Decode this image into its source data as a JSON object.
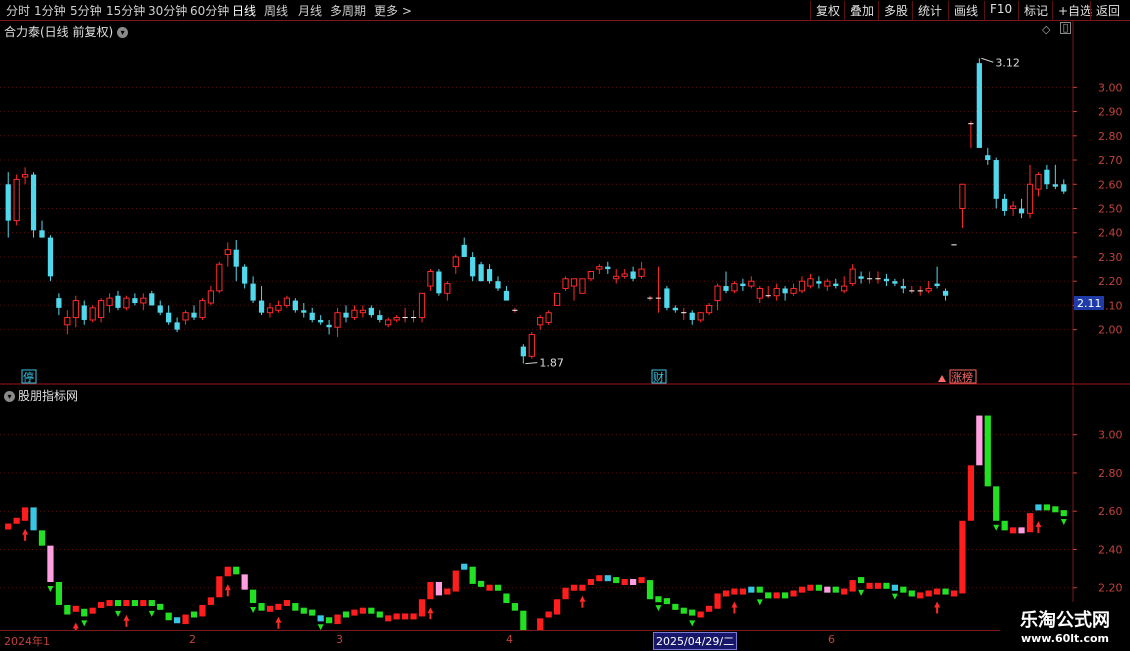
{
  "toolbar": {
    "periods": [
      "分时",
      "1分钟",
      "5分钟",
      "15分钟",
      "30分钟",
      "60分钟",
      "日线",
      "周线",
      "月线",
      "多周期",
      "更多"
    ],
    "active": "日线",
    "more_arrow": ">",
    "right_buttons": [
      "复权",
      "叠加",
      "多股",
      "统计",
      "画线",
      "F10",
      "标记",
      "+自选",
      "返回"
    ]
  },
  "main_panel": {
    "title": "合力泰(日线 前复权)",
    "y_ticks": [
      "3.00",
      "2.90",
      "2.80",
      "2.70",
      "2.60",
      "2.50",
      "2.40",
      "2.30",
      "2.20",
      "2.10",
      "2.00"
    ],
    "current_price": "2.11",
    "high_label": "3.12",
    "low_label": "1.87",
    "events": [
      {
        "text": "停",
        "color": "#39c6e6"
      },
      {
        "text": "财",
        "color": "#39c6e6"
      },
      {
        "text": "涨榜",
        "color": "#ff6a6a"
      }
    ]
  },
  "sub_panel": {
    "title": "股朋指标网",
    "y_ticks": [
      "3.00",
      "2.80",
      "2.60",
      "2.40",
      "2.20"
    ]
  },
  "x_axis": {
    "labels": [
      "2024年1",
      "2",
      "3",
      "4",
      "6"
    ],
    "cursor_date": "2025/04/29/二"
  },
  "watermark": {
    "line1": "乐淘公式网",
    "line2": "www.60lt.com"
  },
  "colors": {
    "up": "#ff2a2a",
    "down": "#52d8ec",
    "axis": "#c0433a",
    "grid": "#5a1010"
  },
  "chart_data": [
    {
      "type": "candlestick",
      "title": "合力泰(日线 前复权)",
      "ylim": [
        1.85,
        3.15
      ],
      "series": [
        {
          "name": "合力泰",
          "values": [
            [
              2.6,
              2.65,
              2.38,
              2.45
            ],
            [
              2.45,
              2.64,
              2.43,
              2.62
            ],
            [
              2.63,
              2.67,
              2.6,
              2.64
            ],
            [
              2.64,
              2.65,
              2.38,
              2.41
            ],
            [
              2.41,
              2.45,
              2.38,
              2.38
            ],
            [
              2.38,
              2.39,
              2.2,
              2.22
            ],
            [
              2.13,
              2.15,
              2.06,
              2.09
            ],
            [
              2.02,
              2.08,
              1.98,
              2.05
            ],
            [
              2.05,
              2.14,
              2.01,
              2.12
            ],
            [
              2.1,
              2.12,
              2.02,
              2.04
            ],
            [
              2.04,
              2.1,
              2.03,
              2.09
            ],
            [
              2.05,
              2.13,
              2.03,
              2.12
            ],
            [
              2.1,
              2.15,
              2.07,
              2.13
            ],
            [
              2.14,
              2.16,
              2.08,
              2.09
            ],
            [
              2.09,
              2.14,
              2.08,
              2.13
            ],
            [
              2.13,
              2.15,
              2.1,
              2.11
            ],
            [
              2.11,
              2.15,
              2.08,
              2.13
            ],
            [
              2.15,
              2.16,
              2.1,
              2.1
            ],
            [
              2.1,
              2.12,
              2.06,
              2.07
            ],
            [
              2.07,
              2.1,
              2.02,
              2.03
            ],
            [
              2.03,
              2.05,
              1.99,
              2.0
            ],
            [
              2.04,
              2.08,
              2.02,
              2.07
            ],
            [
              2.07,
              2.1,
              2.04,
              2.05
            ],
            [
              2.05,
              2.13,
              2.04,
              2.12
            ],
            [
              2.11,
              2.18,
              2.1,
              2.16
            ],
            [
              2.16,
              2.28,
              2.15,
              2.27
            ],
            [
              2.31,
              2.36,
              2.26,
              2.33
            ],
            [
              2.33,
              2.37,
              2.2,
              2.26
            ],
            [
              2.26,
              2.27,
              2.17,
              2.19
            ],
            [
              2.19,
              2.22,
              2.11,
              2.12
            ],
            [
              2.12,
              2.18,
              2.06,
              2.07
            ],
            [
              2.07,
              2.11,
              2.05,
              2.09
            ],
            [
              2.08,
              2.12,
              2.07,
              2.1
            ],
            [
              2.1,
              2.14,
              2.09,
              2.13
            ],
            [
              2.12,
              2.13,
              2.07,
              2.08
            ],
            [
              2.08,
              2.11,
              2.05,
              2.07
            ],
            [
              2.07,
              2.09,
              2.03,
              2.04
            ],
            [
              2.04,
              2.06,
              2.02,
              2.03
            ],
            [
              2.02,
              2.04,
              1.98,
              2.01
            ],
            [
              2.01,
              2.09,
              1.97,
              2.07
            ],
            [
              2.07,
              2.1,
              2.03,
              2.05
            ],
            [
              2.05,
              2.1,
              2.04,
              2.08
            ],
            [
              2.07,
              2.1,
              2.05,
              2.08
            ],
            [
              2.09,
              2.1,
              2.05,
              2.06
            ],
            [
              2.06,
              2.08,
              2.03,
              2.04
            ],
            [
              2.02,
              2.05,
              2.01,
              2.04
            ],
            [
              2.04,
              2.06,
              2.03,
              2.05
            ],
            [
              2.05,
              2.09,
              2.03,
              2.05
            ],
            [
              2.05,
              2.08,
              2.03,
              2.05
            ],
            [
              2.05,
              2.15,
              2.03,
              2.15
            ],
            [
              2.18,
              2.25,
              2.16,
              2.24
            ],
            [
              2.24,
              2.25,
              2.14,
              2.15
            ],
            [
              2.15,
              2.2,
              2.12,
              2.19
            ],
            [
              2.26,
              2.31,
              2.23,
              2.3
            ],
            [
              2.35,
              2.38,
              2.3,
              2.3
            ],
            [
              2.3,
              2.32,
              2.2,
              2.22
            ],
            [
              2.27,
              2.28,
              2.2,
              2.2
            ],
            [
              2.25,
              2.27,
              2.19,
              2.2
            ],
            [
              2.2,
              2.22,
              2.16,
              2.17
            ],
            [
              2.16,
              2.18,
              2.12,
              2.12
            ],
            [
              2.08,
              2.09,
              2.07,
              2.08
            ],
            [
              1.93,
              1.94,
              1.86,
              1.89
            ],
            [
              1.89,
              1.99,
              1.88,
              1.98
            ],
            [
              2.02,
              2.06,
              2.0,
              2.05
            ],
            [
              2.03,
              2.08,
              2.02,
              2.07
            ],
            [
              2.1,
              2.15,
              2.1,
              2.15
            ],
            [
              2.17,
              2.22,
              2.16,
              2.21
            ],
            [
              2.18,
              2.21,
              2.12,
              2.21
            ],
            [
              2.15,
              2.21,
              2.15,
              2.21
            ],
            [
              2.21,
              2.24,
              2.2,
              2.24
            ],
            [
              2.25,
              2.27,
              2.23,
              2.26
            ],
            [
              2.26,
              2.28,
              2.23,
              2.25
            ],
            [
              2.21,
              2.25,
              2.19,
              2.22
            ],
            [
              2.22,
              2.25,
              2.21,
              2.23
            ],
            [
              2.24,
              2.26,
              2.2,
              2.21
            ],
            [
              2.22,
              2.28,
              2.21,
              2.25
            ],
            [
              2.13,
              2.14,
              2.12,
              2.13
            ],
            [
              2.13,
              2.26,
              2.07,
              2.13
            ],
            [
              2.17,
              2.18,
              2.08,
              2.09
            ],
            [
              2.09,
              2.1,
              2.07,
              2.08
            ],
            [
              2.07,
              2.09,
              2.04,
              2.07
            ],
            [
              2.07,
              2.08,
              2.02,
              2.04
            ],
            [
              2.04,
              2.07,
              2.03,
              2.07
            ],
            [
              2.07,
              2.11,
              2.06,
              2.1
            ],
            [
              2.12,
              2.19,
              2.08,
              2.18
            ],
            [
              2.18,
              2.24,
              2.15,
              2.16
            ],
            [
              2.16,
              2.2,
              2.15,
              2.19
            ],
            [
              2.19,
              2.21,
              2.16,
              2.18
            ],
            [
              2.18,
              2.22,
              2.17,
              2.2
            ],
            [
              2.13,
              2.18,
              2.11,
              2.17
            ],
            [
              2.14,
              2.18,
              2.13,
              2.14
            ],
            [
              2.14,
              2.19,
              2.12,
              2.17
            ],
            [
              2.17,
              2.18,
              2.12,
              2.15
            ],
            [
              2.15,
              2.19,
              2.14,
              2.17
            ],
            [
              2.16,
              2.22,
              2.15,
              2.2
            ],
            [
              2.18,
              2.23,
              2.17,
              2.21
            ],
            [
              2.2,
              2.22,
              2.17,
              2.19
            ],
            [
              2.18,
              2.21,
              2.16,
              2.2
            ],
            [
              2.19,
              2.21,
              2.17,
              2.18
            ],
            [
              2.16,
              2.22,
              2.15,
              2.18
            ],
            [
              2.19,
              2.27,
              2.18,
              2.25
            ],
            [
              2.22,
              2.24,
              2.19,
              2.21
            ],
            [
              2.21,
              2.24,
              2.19,
              2.21
            ],
            [
              2.21,
              2.24,
              2.19,
              2.21
            ],
            [
              2.21,
              2.23,
              2.18,
              2.2
            ],
            [
              2.2,
              2.21,
              2.18,
              2.19
            ],
            [
              2.18,
              2.21,
              2.15,
              2.17
            ],
            [
              2.16,
              2.18,
              2.15,
              2.16
            ],
            [
              2.16,
              2.18,
              2.14,
              2.16
            ],
            [
              2.16,
              2.2,
              2.15,
              2.17
            ],
            [
              2.19,
              2.26,
              2.17,
              2.18
            ],
            [
              2.16,
              2.17,
              2.12,
              2.14
            ],
            [
              2.35,
              2.35,
              2.35,
              2.35
            ],
            [
              2.5,
              2.6,
              2.42,
              2.6
            ],
            [
              2.85,
              2.86,
              2.75,
              2.85
            ],
            [
              3.1,
              3.12,
              2.8,
              2.75
            ],
            [
              2.72,
              2.75,
              2.68,
              2.7
            ],
            [
              2.7,
              2.71,
              2.5,
              2.54
            ],
            [
              2.54,
              2.56,
              2.47,
              2.49
            ],
            [
              2.5,
              2.53,
              2.47,
              2.51
            ],
            [
              2.5,
              2.54,
              2.46,
              2.48
            ],
            [
              2.48,
              2.68,
              2.46,
              2.6
            ],
            [
              2.58,
              2.65,
              2.55,
              2.64
            ],
            [
              2.66,
              2.68,
              2.58,
              2.6
            ],
            [
              2.6,
              2.68,
              2.58,
              2.59
            ],
            [
              2.6,
              2.62,
              2.56,
              2.57
            ]
          ]
        }
      ],
      "annotations": [
        "3.12",
        "1.87"
      ],
      "grid": true
    },
    {
      "type": "bar",
      "title": "股朋指标网",
      "ylim": [
        2.0,
        3.15
      ],
      "note": "colored indicator bars following the price series",
      "values": [
        2.52,
        2.55,
        2.62,
        2.5,
        2.42,
        2.23,
        2.11,
        2.06,
        2.09,
        2.05,
        2.08,
        2.11,
        2.12,
        2.1,
        2.12,
        2.11,
        2.12,
        2.1,
        2.07,
        2.03,
        2.01,
        2.06,
        2.05,
        2.11,
        2.15,
        2.26,
        2.31,
        2.27,
        2.19,
        2.12,
        2.08,
        2.09,
        2.1,
        2.12,
        2.08,
        2.07,
        2.04,
        2.03,
        2.01,
        2.06,
        2.05,
        2.07,
        2.08,
        2.06,
        2.04,
        2.04,
        2.05,
        2.05,
        2.05,
        2.14,
        2.23,
        2.16,
        2.18,
        2.29,
        2.31,
        2.22,
        2.2,
        2.2,
        2.17,
        2.12,
        2.08,
        1.9,
        1.97,
        2.04,
        2.06,
        2.14,
        2.2,
        2.2,
        2.2,
        2.23,
        2.25,
        2.24,
        2.22,
        2.23,
        2.21,
        2.24,
        2.14,
        2.13,
        2.1,
        2.08,
        2.07,
        2.05,
        2.06,
        2.09,
        2.17,
        2.17,
        2.18,
        2.18,
        2.19,
        2.16,
        2.15,
        2.16,
        2.15,
        2.17,
        2.19,
        2.2,
        2.19,
        2.19,
        2.18,
        2.18,
        2.24,
        2.21,
        2.21,
        2.21,
        2.2,
        2.19,
        2.17,
        2.16,
        2.16,
        2.17,
        2.18,
        2.15,
        2.17,
        2.55,
        2.84,
        3.1,
        2.73,
        2.55,
        2.5,
        2.5,
        2.49,
        2.59,
        2.62,
        2.61,
        2.59,
        2.58
      ]
    }
  ]
}
